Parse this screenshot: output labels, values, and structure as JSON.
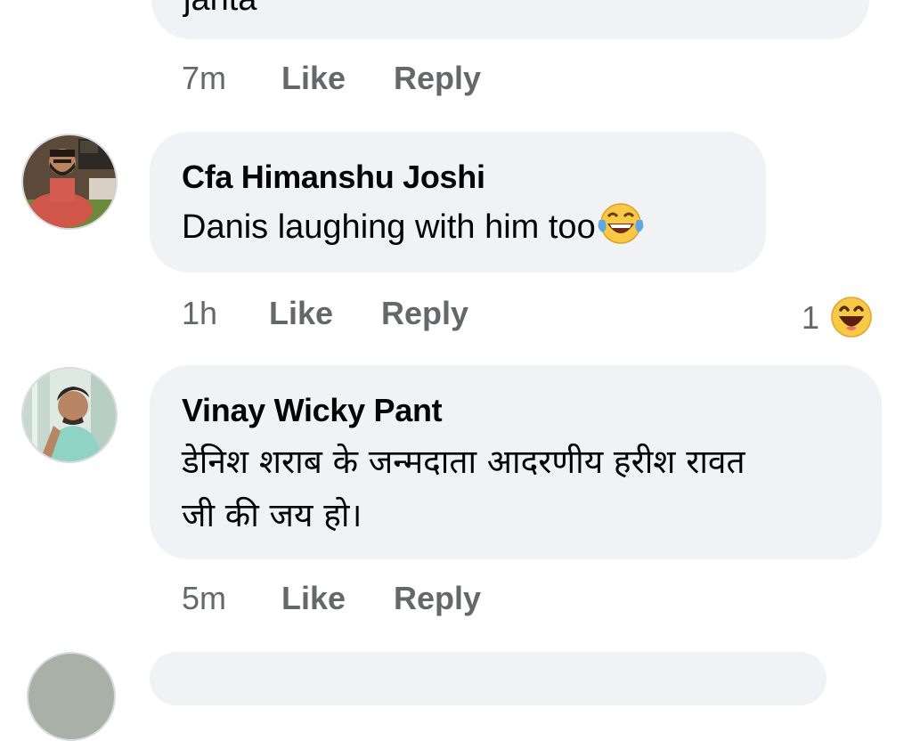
{
  "comments": [
    {
      "text_partial": "janta",
      "time": "7m",
      "like_label": "Like",
      "reply_label": "Reply"
    },
    {
      "author": "Cfa Himanshu Joshi",
      "text": "Danis laughing with him too",
      "emoji": "face-with-tears-of-joy",
      "time": "1h",
      "like_label": "Like",
      "reply_label": "Reply",
      "reaction_count": "1",
      "reaction_type": "haha"
    },
    {
      "author": "Vinay Wicky Pant",
      "text_line1": "डेनिश शराब के जन्मदाता आदरणीय हरीश रावत",
      "text_line2": "जी की जय हो।",
      "time": "5m",
      "like_label": "Like",
      "reply_label": "Reply"
    }
  ],
  "colors": {
    "bubble": "#f0f2f5",
    "meta_text": "#65676b",
    "haha_yellow": "#f7c945"
  }
}
